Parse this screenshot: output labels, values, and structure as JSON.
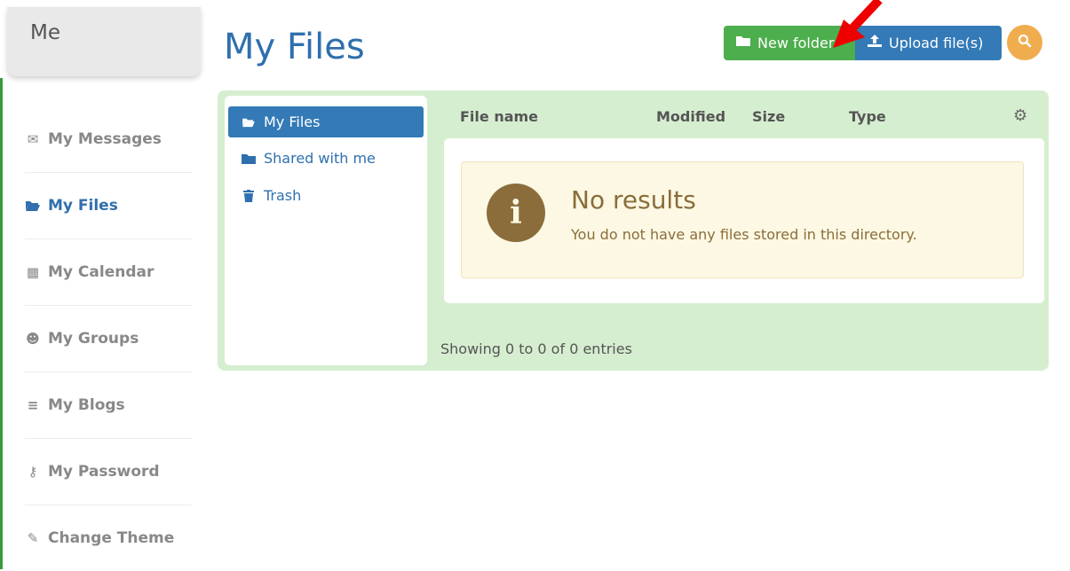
{
  "sidebar": {
    "header": "Me",
    "items": [
      {
        "label": "My Messages",
        "icon": "envelope-icon"
      },
      {
        "label": "My Files",
        "icon": "folder-open-icon",
        "active": true
      },
      {
        "label": "My Calendar",
        "icon": "calendar-icon"
      },
      {
        "label": "My Groups",
        "icon": "users-icon"
      },
      {
        "label": "My Blogs",
        "icon": "list-icon"
      },
      {
        "label": "My Password",
        "icon": "key-icon"
      },
      {
        "label": "Change Theme",
        "icon": "pencil-icon"
      }
    ]
  },
  "page": {
    "title": "My Files"
  },
  "toolbar": {
    "new_folder_label": "New folder",
    "upload_label": "Upload file(s)",
    "search_icon": "search-icon"
  },
  "folders": [
    {
      "label": "My Files",
      "icon": "folder-open-icon",
      "active": true
    },
    {
      "label": "Shared with me",
      "icon": "folder-icon"
    },
    {
      "label": "Trash",
      "icon": "trash-icon"
    }
  ],
  "table": {
    "columns": [
      "File name",
      "Modified",
      "Size",
      "Type"
    ],
    "empty_title": "No results",
    "empty_message": "You do not have any files stored in this directory.",
    "footer": "Showing 0 to 0 of 0 entries"
  },
  "colors": {
    "accent": "#337ab7",
    "success": "#4cae4c",
    "warning": "#f0ad4e",
    "panel_bg": "#d6eed0",
    "arrow": "#ee0000"
  }
}
